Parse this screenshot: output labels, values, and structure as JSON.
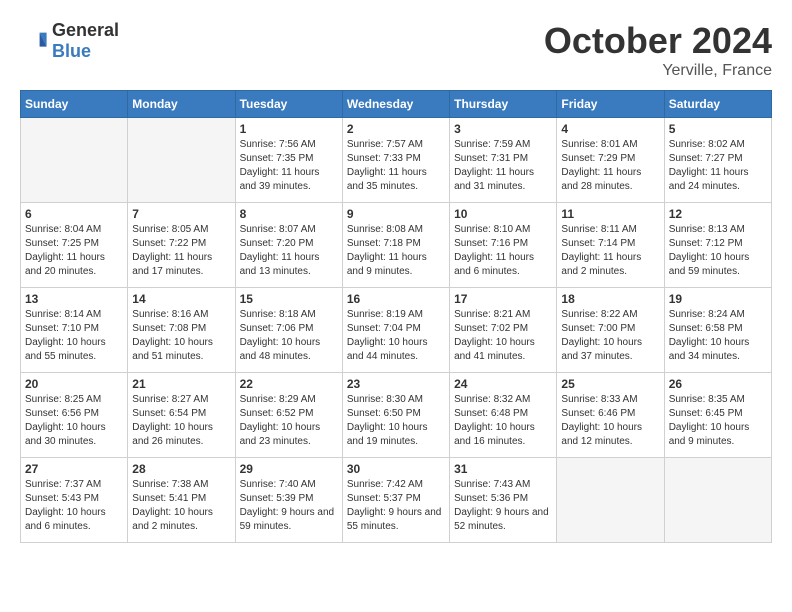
{
  "header": {
    "logo_general": "General",
    "logo_blue": "Blue",
    "month_title": "October 2024",
    "location": "Yerville, France"
  },
  "weekdays": [
    "Sunday",
    "Monday",
    "Tuesday",
    "Wednesday",
    "Thursday",
    "Friday",
    "Saturday"
  ],
  "weeks": [
    [
      {
        "day": "",
        "empty": true
      },
      {
        "day": "",
        "empty": true
      },
      {
        "day": "1",
        "sunrise": "Sunrise: 7:56 AM",
        "sunset": "Sunset: 7:35 PM",
        "daylight": "Daylight: 11 hours and 39 minutes."
      },
      {
        "day": "2",
        "sunrise": "Sunrise: 7:57 AM",
        "sunset": "Sunset: 7:33 PM",
        "daylight": "Daylight: 11 hours and 35 minutes."
      },
      {
        "day": "3",
        "sunrise": "Sunrise: 7:59 AM",
        "sunset": "Sunset: 7:31 PM",
        "daylight": "Daylight: 11 hours and 31 minutes."
      },
      {
        "day": "4",
        "sunrise": "Sunrise: 8:01 AM",
        "sunset": "Sunset: 7:29 PM",
        "daylight": "Daylight: 11 hours and 28 minutes."
      },
      {
        "day": "5",
        "sunrise": "Sunrise: 8:02 AM",
        "sunset": "Sunset: 7:27 PM",
        "daylight": "Daylight: 11 hours and 24 minutes."
      }
    ],
    [
      {
        "day": "6",
        "sunrise": "Sunrise: 8:04 AM",
        "sunset": "Sunset: 7:25 PM",
        "daylight": "Daylight: 11 hours and 20 minutes."
      },
      {
        "day": "7",
        "sunrise": "Sunrise: 8:05 AM",
        "sunset": "Sunset: 7:22 PM",
        "daylight": "Daylight: 11 hours and 17 minutes."
      },
      {
        "day": "8",
        "sunrise": "Sunrise: 8:07 AM",
        "sunset": "Sunset: 7:20 PM",
        "daylight": "Daylight: 11 hours and 13 minutes."
      },
      {
        "day": "9",
        "sunrise": "Sunrise: 8:08 AM",
        "sunset": "Sunset: 7:18 PM",
        "daylight": "Daylight: 11 hours and 9 minutes."
      },
      {
        "day": "10",
        "sunrise": "Sunrise: 8:10 AM",
        "sunset": "Sunset: 7:16 PM",
        "daylight": "Daylight: 11 hours and 6 minutes."
      },
      {
        "day": "11",
        "sunrise": "Sunrise: 8:11 AM",
        "sunset": "Sunset: 7:14 PM",
        "daylight": "Daylight: 11 hours and 2 minutes."
      },
      {
        "day": "12",
        "sunrise": "Sunrise: 8:13 AM",
        "sunset": "Sunset: 7:12 PM",
        "daylight": "Daylight: 10 hours and 59 minutes."
      }
    ],
    [
      {
        "day": "13",
        "sunrise": "Sunrise: 8:14 AM",
        "sunset": "Sunset: 7:10 PM",
        "daylight": "Daylight: 10 hours and 55 minutes."
      },
      {
        "day": "14",
        "sunrise": "Sunrise: 8:16 AM",
        "sunset": "Sunset: 7:08 PM",
        "daylight": "Daylight: 10 hours and 51 minutes."
      },
      {
        "day": "15",
        "sunrise": "Sunrise: 8:18 AM",
        "sunset": "Sunset: 7:06 PM",
        "daylight": "Daylight: 10 hours and 48 minutes."
      },
      {
        "day": "16",
        "sunrise": "Sunrise: 8:19 AM",
        "sunset": "Sunset: 7:04 PM",
        "daylight": "Daylight: 10 hours and 44 minutes."
      },
      {
        "day": "17",
        "sunrise": "Sunrise: 8:21 AM",
        "sunset": "Sunset: 7:02 PM",
        "daylight": "Daylight: 10 hours and 41 minutes."
      },
      {
        "day": "18",
        "sunrise": "Sunrise: 8:22 AM",
        "sunset": "Sunset: 7:00 PM",
        "daylight": "Daylight: 10 hours and 37 minutes."
      },
      {
        "day": "19",
        "sunrise": "Sunrise: 8:24 AM",
        "sunset": "Sunset: 6:58 PM",
        "daylight": "Daylight: 10 hours and 34 minutes."
      }
    ],
    [
      {
        "day": "20",
        "sunrise": "Sunrise: 8:25 AM",
        "sunset": "Sunset: 6:56 PM",
        "daylight": "Daylight: 10 hours and 30 minutes."
      },
      {
        "day": "21",
        "sunrise": "Sunrise: 8:27 AM",
        "sunset": "Sunset: 6:54 PM",
        "daylight": "Daylight: 10 hours and 26 minutes."
      },
      {
        "day": "22",
        "sunrise": "Sunrise: 8:29 AM",
        "sunset": "Sunset: 6:52 PM",
        "daylight": "Daylight: 10 hours and 23 minutes."
      },
      {
        "day": "23",
        "sunrise": "Sunrise: 8:30 AM",
        "sunset": "Sunset: 6:50 PM",
        "daylight": "Daylight: 10 hours and 19 minutes."
      },
      {
        "day": "24",
        "sunrise": "Sunrise: 8:32 AM",
        "sunset": "Sunset: 6:48 PM",
        "daylight": "Daylight: 10 hours and 16 minutes."
      },
      {
        "day": "25",
        "sunrise": "Sunrise: 8:33 AM",
        "sunset": "Sunset: 6:46 PM",
        "daylight": "Daylight: 10 hours and 12 minutes."
      },
      {
        "day": "26",
        "sunrise": "Sunrise: 8:35 AM",
        "sunset": "Sunset: 6:45 PM",
        "daylight": "Daylight: 10 hours and 9 minutes."
      }
    ],
    [
      {
        "day": "27",
        "sunrise": "Sunrise: 7:37 AM",
        "sunset": "Sunset: 5:43 PM",
        "daylight": "Daylight: 10 hours and 6 minutes."
      },
      {
        "day": "28",
        "sunrise": "Sunrise: 7:38 AM",
        "sunset": "Sunset: 5:41 PM",
        "daylight": "Daylight: 10 hours and 2 minutes."
      },
      {
        "day": "29",
        "sunrise": "Sunrise: 7:40 AM",
        "sunset": "Sunset: 5:39 PM",
        "daylight": "Daylight: 9 hours and 59 minutes."
      },
      {
        "day": "30",
        "sunrise": "Sunrise: 7:42 AM",
        "sunset": "Sunset: 5:37 PM",
        "daylight": "Daylight: 9 hours and 55 minutes."
      },
      {
        "day": "31",
        "sunrise": "Sunrise: 7:43 AM",
        "sunset": "Sunset: 5:36 PM",
        "daylight": "Daylight: 9 hours and 52 minutes."
      },
      {
        "day": "",
        "empty": true
      },
      {
        "day": "",
        "empty": true
      }
    ]
  ]
}
